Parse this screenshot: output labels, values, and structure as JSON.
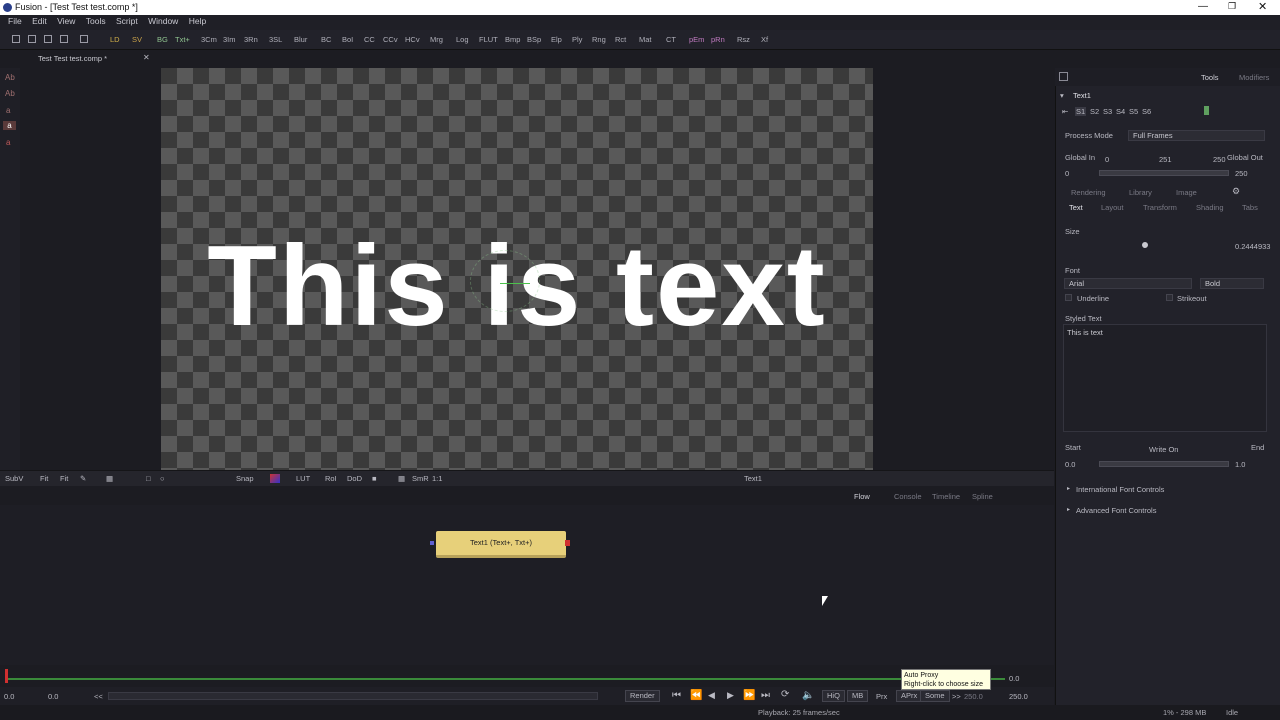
{
  "window": {
    "title": "Fusion - [Test Test test.comp *]"
  },
  "menu": [
    "File",
    "Edit",
    "View",
    "Tools",
    "Script",
    "Window",
    "Help"
  ],
  "toolbar": {
    "tools": [
      "LD",
      "SV",
      "BG",
      "Txt+",
      "3Cm",
      "3Im",
      "3Rn",
      "3SL",
      "Blur",
      "BC",
      "BoI",
      "CC",
      "CCv",
      "HCv",
      "Mrg",
      "Log",
      "FLUT",
      "Bmp",
      "BSp",
      "Elp",
      "Ply",
      "Rng",
      "Rct",
      "Mat",
      "CT",
      "pEm",
      "pRn",
      "Rsz",
      "Xf"
    ]
  },
  "doc_tab": "Test Test test.comp *",
  "left_strip": [
    "Ab",
    "Ab",
    "a",
    "a",
    "a"
  ],
  "viewer": {
    "text": "This is text"
  },
  "viewer_bar": {
    "subv": "SubV",
    "fit": "Fit",
    "fit2": "Fit",
    "snap": "Snap",
    "lut": "LUT",
    "roi": "RoI",
    "dod": "DoD",
    "smr": "SmR",
    "ratio": "1:1",
    "name": "Text1"
  },
  "flow_tabs": [
    "Flow",
    "Console",
    "Timeline",
    "Spline"
  ],
  "node": {
    "label": "Text1 (Text+, Txt+)"
  },
  "timeline": {
    "start": "0.0",
    "current": "0.0",
    "end": "250.0",
    "render_end": "250.0",
    "frame": "0.0"
  },
  "transport": {
    "render": "Render",
    "hiq": "HiQ",
    "mb": "MB",
    "prx": "Prx",
    "aprx": "APrx",
    "some": "Some",
    "lt": "<<",
    "gt": ">>"
  },
  "tooltip": {
    "line1": "Auto Proxy",
    "line2": "Right-click to choose size"
  },
  "status": {
    "playback": "Playback: 25 frames/sec",
    "mem": "1% - 298 MB",
    "state": "Idle"
  },
  "inspector": {
    "tabs": [
      "Tools",
      "Modifiers"
    ],
    "tool_name": "Text1",
    "versions": [
      "S1",
      "S2",
      "S3",
      "S4",
      "S5",
      "S6"
    ],
    "process_mode_label": "Process Mode",
    "process_mode": "Full Frames",
    "global_in_label": "Global In",
    "global_out_label": "Global Out",
    "global_in_min": "0",
    "global_mid": "251",
    "global_out_max": "250",
    "global_in_val": "0",
    "global_out_val": "250",
    "subtabs_row1": [
      "Rendering",
      "Library",
      "Image"
    ],
    "subtabs_row2": [
      "Text",
      "Layout",
      "Transform",
      "Shading",
      "Tabs"
    ],
    "size_label": "Size",
    "size_value": "0.2444933",
    "font_label": "Font",
    "font": "Arial",
    "style": "Bold",
    "underline": "Underline",
    "strikeout": "Strikeout",
    "styled_text_label": "Styled Text",
    "styled_text": "This is text",
    "start_label": "Start",
    "write_on_label": "Write On",
    "end_label": "End",
    "start_val": "0.0",
    "end_val": "1.0",
    "section1": "International Font Controls",
    "section2": "Advanced Font Controls"
  },
  "colors": {
    "node": "#e7d07a",
    "accent": "#d2b04a"
  }
}
